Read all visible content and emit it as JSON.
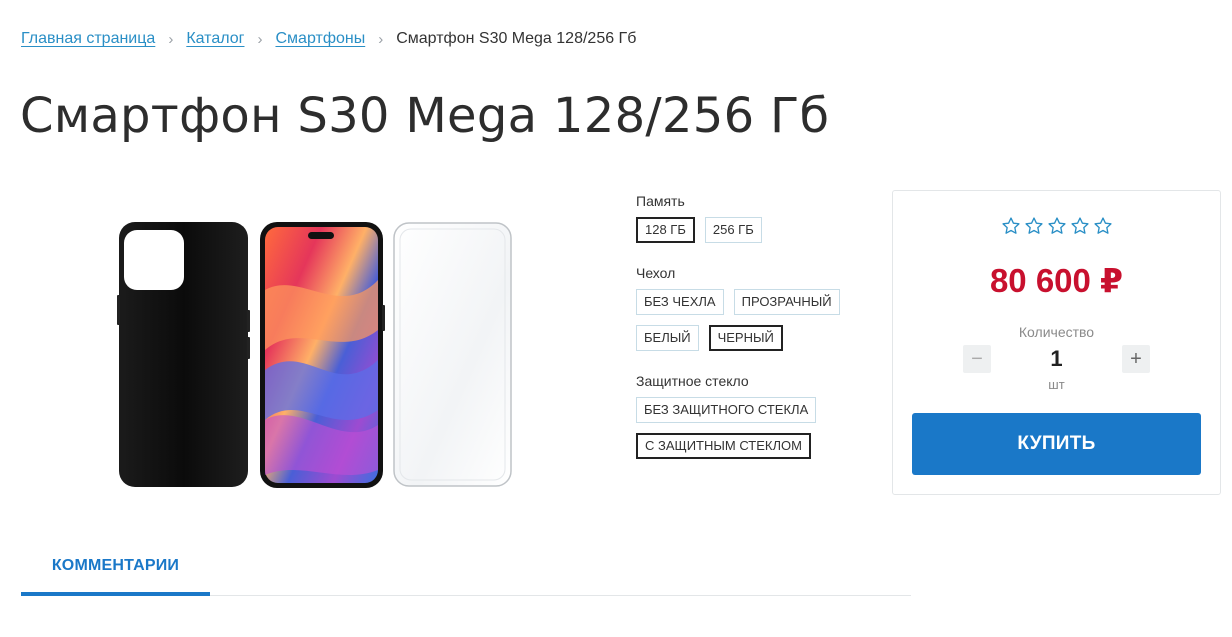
{
  "breadcrumb": {
    "items": [
      "Главная страница",
      "Каталог",
      "Смартфоны"
    ],
    "separator": "›",
    "current": "Смартфон S30 Mega 128/256 Гб"
  },
  "page_title": "Смартфон S30 Mega 128/256 Гб",
  "options": {
    "memory": {
      "label": "Память",
      "choices": [
        "128 ГБ",
        "256 ГБ"
      ],
      "selected": "128 ГБ"
    },
    "case": {
      "label": "Чехол",
      "choices": [
        "БЕЗ ЧЕХЛА",
        "ПРОЗРАЧНЫЙ",
        "БЕЛЫЙ",
        "ЧЕРНЫЙ"
      ],
      "selected": "ЧЕРНЫЙ"
    },
    "glass": {
      "label": "Защитное стекло",
      "choices": [
        "БЕЗ ЗАЩИТНОГО СТЕКЛА",
        "С ЗАЩИТНЫМ СТЕКЛОМ"
      ],
      "selected": "С ЗАЩИТНЫМ СТЕКЛОМ"
    }
  },
  "buy_box": {
    "rating": {
      "value": 0,
      "max": 5,
      "icon": "star-outline-icon"
    },
    "price": "80 600 ₽",
    "quantity_label": "Количество",
    "quantity": "1",
    "minus_label": "−",
    "plus_label": "+",
    "unit": "шт",
    "buy_label": "КУПИТЬ"
  },
  "tabs": [
    {
      "label": "КОММЕНТАРИИ",
      "active": true
    }
  ],
  "colors": {
    "link": "#2a8fc6",
    "accent": "#1a78c8",
    "price": "#c8102e"
  }
}
